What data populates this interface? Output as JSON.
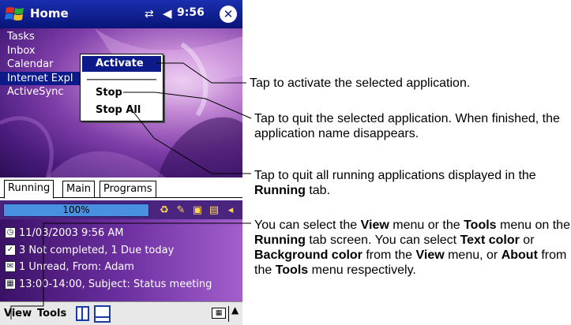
{
  "titlebar": {
    "title": "Home",
    "time": "9:56",
    "icons": [
      "start-flag-icon",
      "connectivity-icon",
      "volume-icon",
      "close-icon"
    ]
  },
  "running_apps": [
    "Tasks",
    "Inbox",
    "Calendar",
    "Internet Expl",
    "ActiveSync"
  ],
  "selected_app_index": 3,
  "context_menu": {
    "activate": "Activate",
    "stop": "Stop",
    "stop_all": "Stop All"
  },
  "tabs": [
    "Running",
    "Main",
    "Programs"
  ],
  "status": {
    "progress_label": "100%",
    "progress_value": 1.0
  },
  "today": {
    "date": "11/03/2003 9:56 AM",
    "tasks": "3 Not completed, 1 Due today",
    "inbox": "1 Unread, From: Adam",
    "calendar": "13:00-14:00, Subject: Status meeting"
  },
  "menubar": {
    "view": "View",
    "tools": "Tools"
  },
  "callouts": {
    "activate": "Tap to activate the selected application.",
    "stop": "Tap to quit the selected application. When finished, the application name disappears.",
    "stop_all_prefix": "Tap to quit all running applications displayed in the",
    "stop_all_bold": "Running",
    "stop_all_suffix": "tab.",
    "menus_parts": [
      {
        "t": "You can select the ",
        "b": false
      },
      {
        "t": "View",
        "b": true
      },
      {
        "t": " menu or the ",
        "b": false
      },
      {
        "t": "Tools",
        "b": true
      },
      {
        "t": " menu on the ",
        "b": false
      },
      {
        "t": "Running",
        "b": true
      },
      {
        "t": " tab screen. You can select ",
        "b": false
      },
      {
        "t": "Text color",
        "b": true
      },
      {
        "t": " or ",
        "b": false
      },
      {
        "t": "Background color",
        "b": true
      },
      {
        "t": " from the ",
        "b": false
      },
      {
        "t": "View",
        "b": true
      },
      {
        "t": " menu, or ",
        "b": false
      },
      {
        "t": "About",
        "b": true
      },
      {
        "t": " from the ",
        "b": false
      },
      {
        "t": "Tools",
        "b": true
      },
      {
        "t": " menu respectively.",
        "b": false
      }
    ]
  },
  "colors": {
    "titlebar": "#0c1a8a",
    "selection": "#0c1a8a",
    "wallpaper": "#7f3ea8",
    "progress": "#4a90e0"
  }
}
